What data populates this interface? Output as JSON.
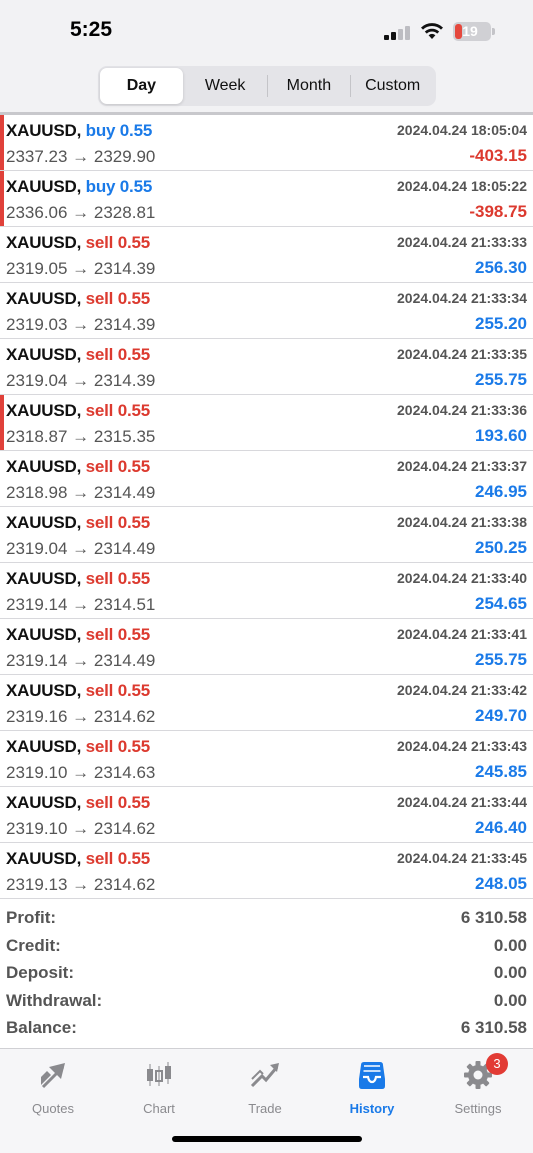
{
  "status": {
    "time": "5:25",
    "battery": "19"
  },
  "segments": [
    {
      "label": "Day",
      "active": true
    },
    {
      "label": "Week",
      "active": false
    },
    {
      "label": "Month",
      "active": false
    },
    {
      "label": "Custom",
      "active": false
    }
  ],
  "trades": [
    {
      "symbol": "XAUUSD,",
      "side": "buy",
      "volume": "buy 0.55",
      "time": "2024.04.24 18:05:04",
      "prices": "2337.23 → 2329.90",
      "profit": "-403.15",
      "marked": true
    },
    {
      "symbol": "XAUUSD,",
      "side": "buy",
      "volume": "buy 0.55",
      "time": "2024.04.24 18:05:22",
      "prices": "2336.06 → 2328.81",
      "profit": "-398.75",
      "marked": true
    },
    {
      "symbol": "XAUUSD,",
      "side": "sell",
      "volume": "sell 0.55",
      "time": "2024.04.24 21:33:33",
      "prices": "2319.05 → 2314.39",
      "profit": "256.30",
      "marked": false
    },
    {
      "symbol": "XAUUSD,",
      "side": "sell",
      "volume": "sell 0.55",
      "time": "2024.04.24 21:33:34",
      "prices": "2319.03 → 2314.39",
      "profit": "255.20",
      "marked": false
    },
    {
      "symbol": "XAUUSD,",
      "side": "sell",
      "volume": "sell 0.55",
      "time": "2024.04.24 21:33:35",
      "prices": "2319.04 → 2314.39",
      "profit": "255.75",
      "marked": false
    },
    {
      "symbol": "XAUUSD,",
      "side": "sell",
      "volume": "sell 0.55",
      "time": "2024.04.24 21:33:36",
      "prices": "2318.87 → 2315.35",
      "profit": "193.60",
      "marked": true
    },
    {
      "symbol": "XAUUSD,",
      "side": "sell",
      "volume": "sell 0.55",
      "time": "2024.04.24 21:33:37",
      "prices": "2318.98 → 2314.49",
      "profit": "246.95",
      "marked": false
    },
    {
      "symbol": "XAUUSD,",
      "side": "sell",
      "volume": "sell 0.55",
      "time": "2024.04.24 21:33:38",
      "prices": "2319.04 → 2314.49",
      "profit": "250.25",
      "marked": false
    },
    {
      "symbol": "XAUUSD,",
      "side": "sell",
      "volume": "sell 0.55",
      "time": "2024.04.24 21:33:40",
      "prices": "2319.14 → 2314.51",
      "profit": "254.65",
      "marked": false
    },
    {
      "symbol": "XAUUSD,",
      "side": "sell",
      "volume": "sell 0.55",
      "time": "2024.04.24 21:33:41",
      "prices": "2319.14 → 2314.49",
      "profit": "255.75",
      "marked": false
    },
    {
      "symbol": "XAUUSD,",
      "side": "sell",
      "volume": "sell 0.55",
      "time": "2024.04.24 21:33:42",
      "prices": "2319.16 → 2314.62",
      "profit": "249.70",
      "marked": false
    },
    {
      "symbol": "XAUUSD,",
      "side": "sell",
      "volume": "sell 0.55",
      "time": "2024.04.24 21:33:43",
      "prices": "2319.10 → 2314.63",
      "profit": "245.85",
      "marked": false
    },
    {
      "symbol": "XAUUSD,",
      "side": "sell",
      "volume": "sell 0.55",
      "time": "2024.04.24 21:33:44",
      "prices": "2319.10 → 2314.62",
      "profit": "246.40",
      "marked": false
    },
    {
      "symbol": "XAUUSD,",
      "side": "sell",
      "volume": "sell 0.55",
      "time": "2024.04.24 21:33:45",
      "prices": "2319.13 → 2314.62",
      "profit": "248.05",
      "marked": false
    }
  ],
  "summary": [
    {
      "label": "Profit:",
      "value": "6 310.58"
    },
    {
      "label": "Credit:",
      "value": "0.00"
    },
    {
      "label": "Deposit:",
      "value": "0.00"
    },
    {
      "label": "Withdrawal:",
      "value": "0.00"
    },
    {
      "label": "Balance:",
      "value": "6 310.58"
    }
  ],
  "tabs": [
    {
      "label": "Quotes",
      "icon": "quotes-icon",
      "active": false
    },
    {
      "label": "Chart",
      "icon": "chart-icon",
      "active": false
    },
    {
      "label": "Trade",
      "icon": "trade-icon",
      "active": false
    },
    {
      "label": "History",
      "icon": "history-icon",
      "active": true
    },
    {
      "label": "Settings",
      "icon": "gear-icon",
      "active": false,
      "badge": "3"
    }
  ],
  "colors": {
    "buy": "#1a7ae8",
    "sell": "#dc3a2f",
    "accent": "#1a7ae8",
    "marker": "#e0413a"
  }
}
